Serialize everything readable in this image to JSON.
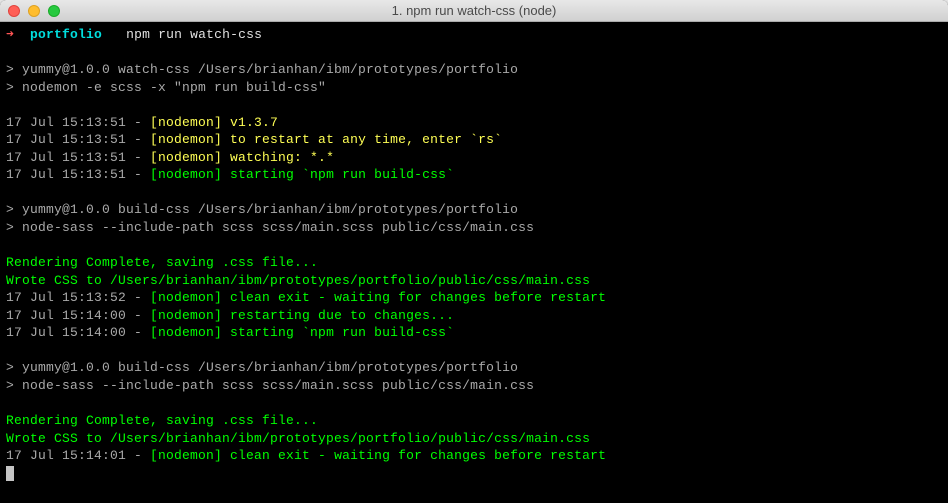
{
  "window": {
    "title": "1. npm run watch-css (node)"
  },
  "prompt": {
    "arrow": "➜",
    "dir": "portfolio",
    "command": "npm run watch-css"
  },
  "lines": {
    "l1": "> yummy@1.0.0 watch-css /Users/brianhan/ibm/prototypes/portfolio",
    "l2": "> nodemon -e scss -x \"npm run build-css\"",
    "ts1": "17 Jul 15:13:51 - ",
    "nm": "[nodemon]",
    "nm1a": " v1.3.7",
    "nm1b": " to restart at any time, enter `rs`",
    "nm1c": " watching: *.*",
    "nm1d": " starting `npm run build-css`",
    "l3": "> yummy@1.0.0 build-css /Users/brianhan/ibm/prototypes/portfolio",
    "l4": "> node-sass --include-path scss scss/main.scss public/css/main.css",
    "rc": "Rendering Complete, saving .css file...",
    "wc": "Wrote CSS to /Users/brianhan/ibm/prototypes/portfolio/public/css/main.css",
    "ts2": "17 Jul 15:13:52 - ",
    "nm2a": " clean exit - waiting for changes before restart",
    "ts3": "17 Jul 15:14:00 - ",
    "nm3a": " restarting due to changes...",
    "nm3b": " starting `npm run build-css`",
    "ts4": "17 Jul 15:14:01 - ",
    "nm4a": " clean exit - waiting for changes before restart"
  }
}
